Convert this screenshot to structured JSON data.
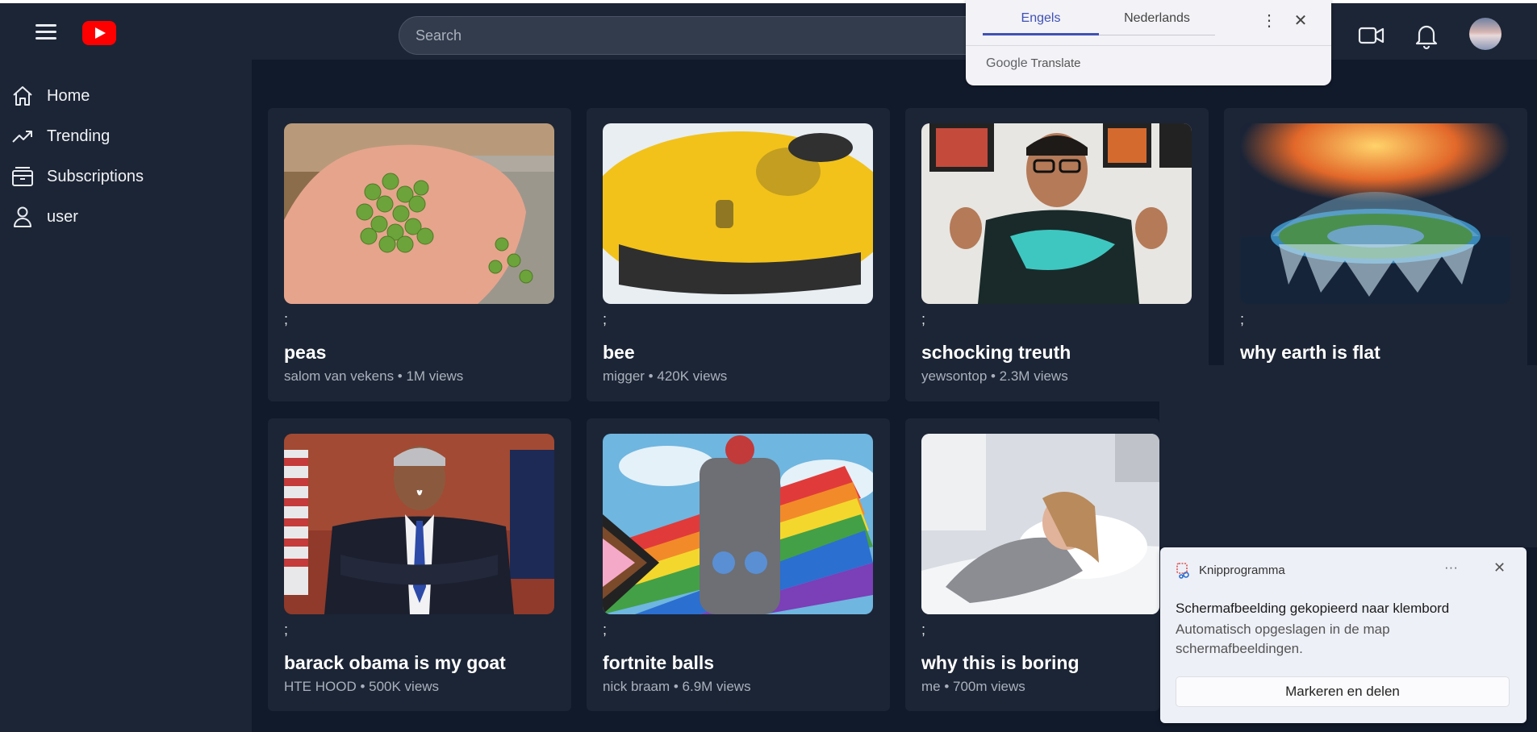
{
  "header": {
    "search_placeholder": "Search"
  },
  "sidebar": {
    "items": [
      {
        "label": "Home"
      },
      {
        "label": "Trending"
      },
      {
        "label": "Subscriptions"
      },
      {
        "label": "user"
      }
    ]
  },
  "videos": [
    {
      "prefix": ";",
      "title": "peas",
      "meta": "salom van vekens • 1M views"
    },
    {
      "prefix": ";",
      "title": "bee",
      "meta": "migger • 420K views"
    },
    {
      "prefix": ";",
      "title": "schocking treuth",
      "meta": "yewsontop • 2.3M views"
    },
    {
      "prefix": ";",
      "title": "why earth is flat",
      "meta": ""
    },
    {
      "prefix": ";",
      "title": "barack obama is my goat",
      "meta": "HTE HOOD • 500K views"
    },
    {
      "prefix": ";",
      "title": "fortnite balls",
      "meta": "nick braam • 6.9M views"
    },
    {
      "prefix": ";",
      "title": "why this is boring",
      "meta": "me • 700m views"
    }
  ],
  "translate_popup": {
    "tab_source": "Engels",
    "tab_target": "Nederlands",
    "brand_google": "Google",
    "brand_translate": "Translate"
  },
  "notification": {
    "app": "Knipprogramma",
    "title": "Schermafbeelding gekopieerd naar klembord",
    "body": "Automatisch opgeslagen in de map schermafbeeldingen.",
    "action": "Markeren en delen",
    "more": "···"
  },
  "icons": [
    "menu-icon",
    "youtube-logo",
    "video-camera-icon",
    "bell-icon",
    "home-icon",
    "trending-icon",
    "subscriptions-icon",
    "user-icon",
    "more-vertical-icon",
    "close-icon",
    "snipping-tool-icon"
  ]
}
